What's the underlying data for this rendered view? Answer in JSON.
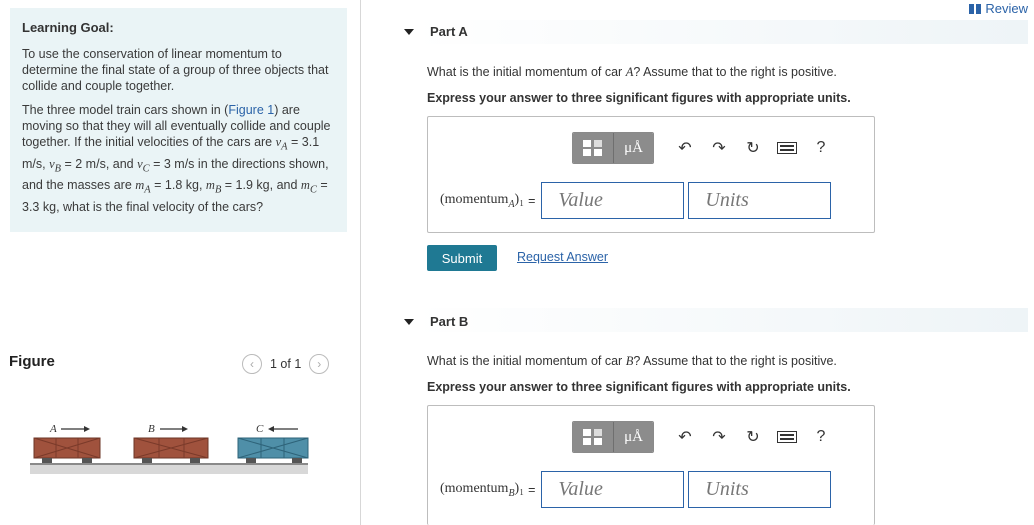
{
  "review": {
    "label": "Review"
  },
  "goal": {
    "title": "Learning Goal:",
    "paragraph1": "To use the conservation of linear momentum to determine the final state of a group of three objects that collide and couple together.",
    "p2_a": "The three model train cars shown in (",
    "p2_link": "Figure 1",
    "p2_b": ") are moving so that they will all eventually collide and couple together. If the initial velocities of the cars are ",
    "vA": "v",
    "vA_sub": "A",
    "vA_val": " = 3.1 m/s",
    "vB_sub": "B",
    "vB_val": " = 2 m/s",
    "vC_sub": "C",
    "vC_val": " = 3 m/s",
    "p2_c": " in the directions shown, and the masses are ",
    "mA_val": " = 1.8 kg",
    "mB_val": " = 1.9 kg",
    "mC_val": " = 3.3 kg",
    "p2_d": ", what is the final velocity of the cars?"
  },
  "figure": {
    "title": "Figure",
    "page_label": "1 of 1",
    "car_labels": [
      "A",
      "B",
      "C"
    ]
  },
  "partA": {
    "header": "Part A",
    "question": "What is the initial momentum of car A? Assume that to the right is positive.",
    "instruction": "Express your answer to three significant figures with appropriate units.",
    "lhs_main": "(momentum",
    "lhs_sub": "A",
    "lhs_tail": ")₁",
    "equals": "=",
    "value_placeholder": "Value",
    "units_placeholder": "Units",
    "submit_label": "Submit",
    "request_label": "Request Answer"
  },
  "partB": {
    "header": "Part B",
    "question": "What is the initial momentum of car B? Assume that to the right is positive.",
    "instruction": "Express your answer to three significant figures with appropriate units.",
    "lhs_main": "(momentum",
    "lhs_sub": "B",
    "lhs_tail": ")₁",
    "equals": "=",
    "value_placeholder": "Value",
    "units_placeholder": "Units"
  },
  "toolbar": {
    "unit_symbol": "μÅ",
    "help": "?"
  },
  "colors": {
    "accent": "#1f7993",
    "link": "#2b63a8",
    "goal_bg": "#eaf4f6",
    "part_bar": "#e4eef4"
  }
}
